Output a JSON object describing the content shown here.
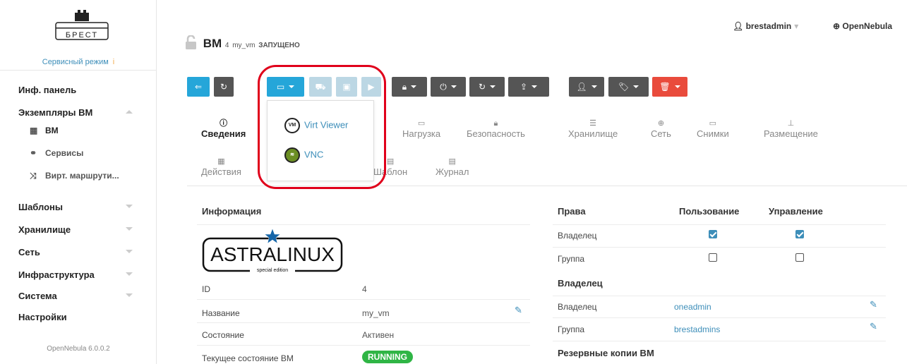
{
  "sidebar": {
    "logo_text": "БРЕСТ",
    "service_mode": "Сервисный режим",
    "menu": [
      {
        "label": "Инф. панель"
      },
      {
        "label": "Экземпляры ВМ"
      },
      {
        "label": "Шаблоны"
      },
      {
        "label": "Хранилище"
      },
      {
        "label": "Сеть"
      },
      {
        "label": "Инфраструктура"
      },
      {
        "label": "Система"
      },
      {
        "label": "Настройки"
      }
    ],
    "submenu": [
      {
        "label": "ВМ"
      },
      {
        "label": "Сервисы"
      },
      {
        "label": "Вирт. маршрути..."
      }
    ],
    "version": "OpenNebula 6.0.0.2"
  },
  "topbar": {
    "user": "brestadmin",
    "zone": "OpenNebula"
  },
  "header": {
    "title": "ВМ",
    "vm_id": "4",
    "vm_name": "my_vm",
    "state": "ЗАПУЩЕНО"
  },
  "console_menu": {
    "items": [
      {
        "label": "Virt Viewer",
        "icon": "virt-viewer-icon"
      },
      {
        "label": "VNC",
        "icon": "vnc-icon"
      }
    ]
  },
  "tabs": {
    "row1": [
      {
        "label": "Сведения"
      },
      {
        "label": "Нагрузка"
      },
      {
        "label": "Безопасность"
      },
      {
        "label": "Хранилище"
      },
      {
        "label": "Сеть"
      },
      {
        "label": "Снимки"
      },
      {
        "label": "Размещение"
      }
    ],
    "row2": [
      {
        "label": "Действия"
      },
      {
        "label": "Шаблон"
      },
      {
        "label": "Журнал"
      }
    ]
  },
  "info": {
    "title": "Информация",
    "logo_text": "ASTRALINUX",
    "logo_sub": "special edition",
    "rows": [
      {
        "label": "ID",
        "value": "4"
      },
      {
        "label": "Название",
        "value": "my_vm"
      },
      {
        "label": "Состояние",
        "value": "Активен"
      },
      {
        "label": "Текущее состояние ВМ",
        "value": "RUNNING"
      }
    ]
  },
  "permissions": {
    "title": "Права",
    "col_use": "Пользование",
    "col_manage": "Управление",
    "rows": [
      {
        "label": "Владелец",
        "use": true,
        "manage": true
      },
      {
        "label": "Группа",
        "use": false,
        "manage": false
      }
    ]
  },
  "ownership": {
    "title": "Владелец",
    "rows": [
      {
        "label": "Владелец",
        "value": "oneadmin"
      },
      {
        "label": "Группа",
        "value": "brestadmins"
      }
    ]
  },
  "backups": {
    "title": "Резервные копии ВМ"
  },
  "colors": {
    "accent": "#25a6d9",
    "danger": "#e94b3c",
    "running": "#2fb545",
    "highlight": "#e0001b"
  }
}
